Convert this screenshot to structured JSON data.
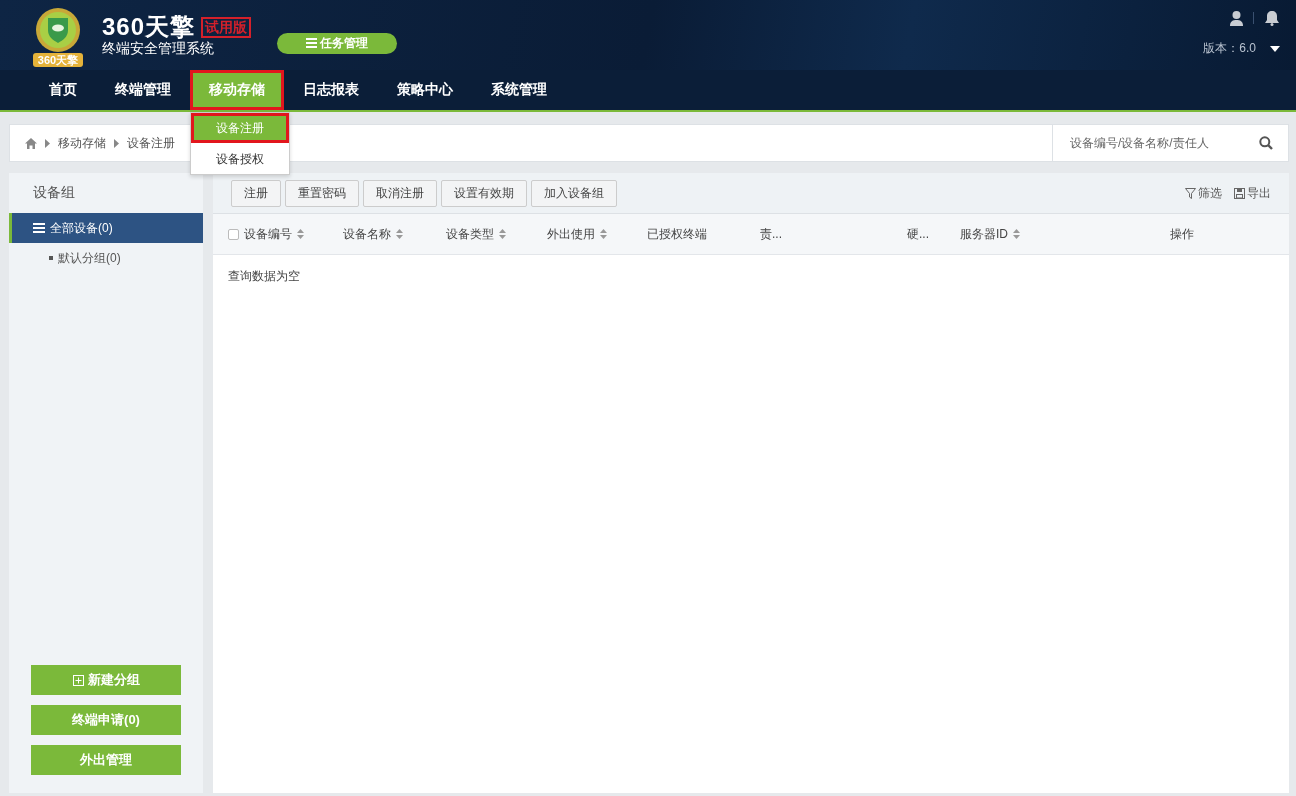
{
  "header": {
    "logo_badge": "360天擎",
    "logo_title": "360天擎",
    "logo_stamp": "试用版",
    "logo_subtitle": "终端安全管理系统",
    "task_button": "任务管理",
    "version": "版本：6.0"
  },
  "nav": [
    {
      "label": "首页",
      "selected": false,
      "highlighted": false
    },
    {
      "label": "终端管理",
      "selected": false,
      "highlighted": false
    },
    {
      "label": "移动存储",
      "selected": true,
      "highlighted": true
    },
    {
      "label": "日志报表",
      "selected": false,
      "highlighted": false
    },
    {
      "label": "策略中心",
      "selected": false,
      "highlighted": false
    },
    {
      "label": "系统管理",
      "selected": false,
      "highlighted": false
    }
  ],
  "dropdown": [
    {
      "label": "设备注册",
      "selected": true,
      "highlighted": true
    },
    {
      "label": "设备授权",
      "selected": false,
      "highlighted": false
    }
  ],
  "breadcrumb": [
    "移动存储",
    "设备注册"
  ],
  "search": {
    "placeholder": "设备编号/设备名称/责任人"
  },
  "sidebar": {
    "title": "设备组",
    "tree": [
      {
        "label": "全部设备(0)",
        "selected": true,
        "children": [
          {
            "label": "默认分组(0)",
            "selected": false
          }
        ]
      }
    ],
    "buttons": [
      {
        "label": "新建分组",
        "kind": "add"
      },
      {
        "label": "终端申请(0)",
        "kind": "plain"
      },
      {
        "label": "外出管理",
        "kind": "plain"
      }
    ]
  },
  "toolbar": {
    "buttons": [
      "注册",
      "重置密码",
      "取消注册",
      "设置有效期",
      "加入设备组"
    ],
    "filter": "筛选",
    "export": "导出"
  },
  "table": {
    "columns": [
      {
        "label": "设备编号",
        "kind": "select"
      },
      {
        "label": "设备名称",
        "kind": "sortable"
      },
      {
        "label": "设备类型",
        "kind": "sortable"
      },
      {
        "label": "外出使用",
        "kind": "sortable"
      },
      {
        "label": "已授权终端",
        "kind": "plain"
      },
      {
        "label": "责...",
        "kind": "plain"
      },
      {
        "label": "硬...",
        "kind": "plain"
      },
      {
        "label": "服务器ID",
        "kind": "sortable"
      },
      {
        "label": "操作",
        "kind": "plain"
      }
    ],
    "select_all": {
      "checked": false
    },
    "empty_message": "查询数据为空"
  }
}
